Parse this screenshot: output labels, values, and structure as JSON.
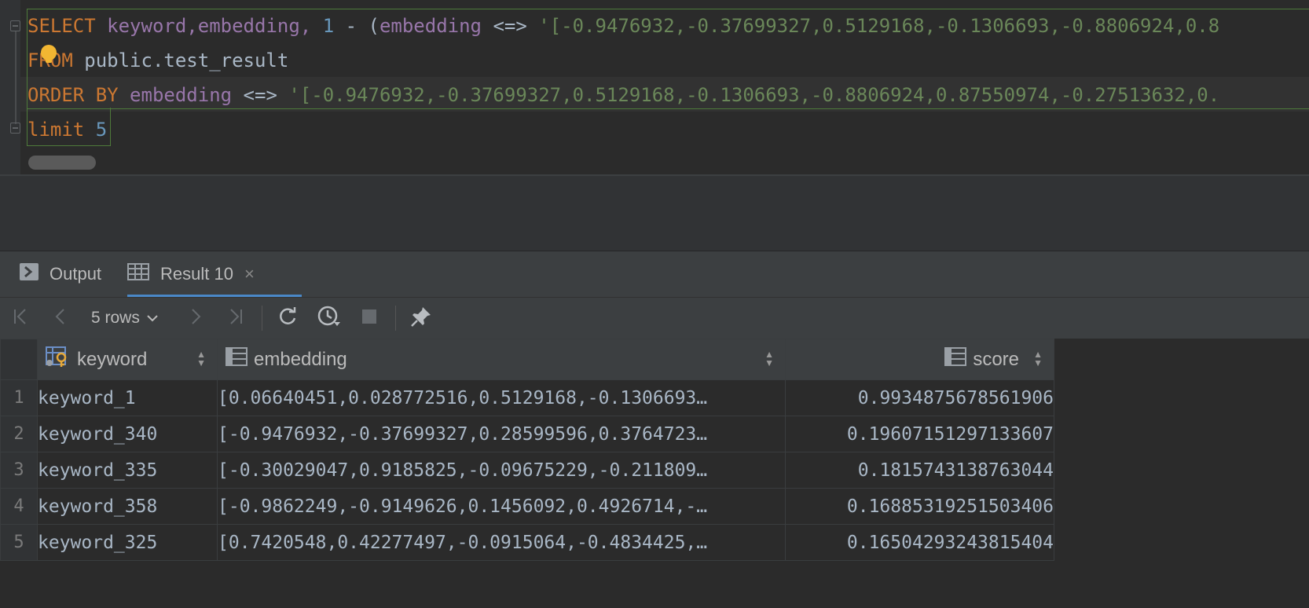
{
  "editor": {
    "line1": {
      "kw_select": "SELECT",
      "cols": " keyword,embedding,",
      "num1": " 1",
      "op1": " - (",
      "col_emb": "embedding",
      "op2": " <=> ",
      "str": "'[-0.9476932,-0.37699327,0.5129168,-0.1306693,-0.8806924,0.8"
    },
    "line2": {
      "kw_from": "FROM",
      "table": " public.test_result"
    },
    "line3": {
      "kw_order": "ORDER BY",
      "col_emb": " embedding",
      "op": " <=> ",
      "str": "'[-0.9476932,-0.37699327,0.5129168,-0.1306693,-0.8806924,0.87550974,-0.27513632,0."
    },
    "line4": {
      "kw_limit": "limit",
      "num": " 5"
    }
  },
  "tabs": {
    "output_label": "Output",
    "result_label": "Result 10",
    "close_icon": "×"
  },
  "toolbar": {
    "rows_label": "5 rows"
  },
  "grid": {
    "columns": [
      "keyword",
      "embedding",
      "score"
    ],
    "rows": [
      {
        "n": "1",
        "keyword": "keyword_1",
        "embedding": "[0.06640451,0.028772516,0.5129168,-0.1306693…",
        "score": "0.9934875678561906"
      },
      {
        "n": "2",
        "keyword": "keyword_340",
        "embedding": "[-0.9476932,-0.37699327,0.28599596,0.3764723…",
        "score": "0.19607151297133607"
      },
      {
        "n": "3",
        "keyword": "keyword_335",
        "embedding": "[-0.30029047,0.9185825,-0.09675229,-0.211809…",
        "score": "0.1815743138763044"
      },
      {
        "n": "4",
        "keyword": "keyword_358",
        "embedding": "[-0.9862249,-0.9149626,0.1456092,0.4926714,-…",
        "score": "0.16885319251503406"
      },
      {
        "n": "5",
        "keyword": "keyword_325",
        "embedding": "[0.7420548,0.42277497,-0.0915064,-0.4834425,…",
        "score": "0.16504293243815404"
      }
    ]
  },
  "colors": {
    "keyword": "#cc7832",
    "column": "#9876aa",
    "number": "#6897bb",
    "string": "#6a8759",
    "tab_accent": "#4a88c7"
  }
}
